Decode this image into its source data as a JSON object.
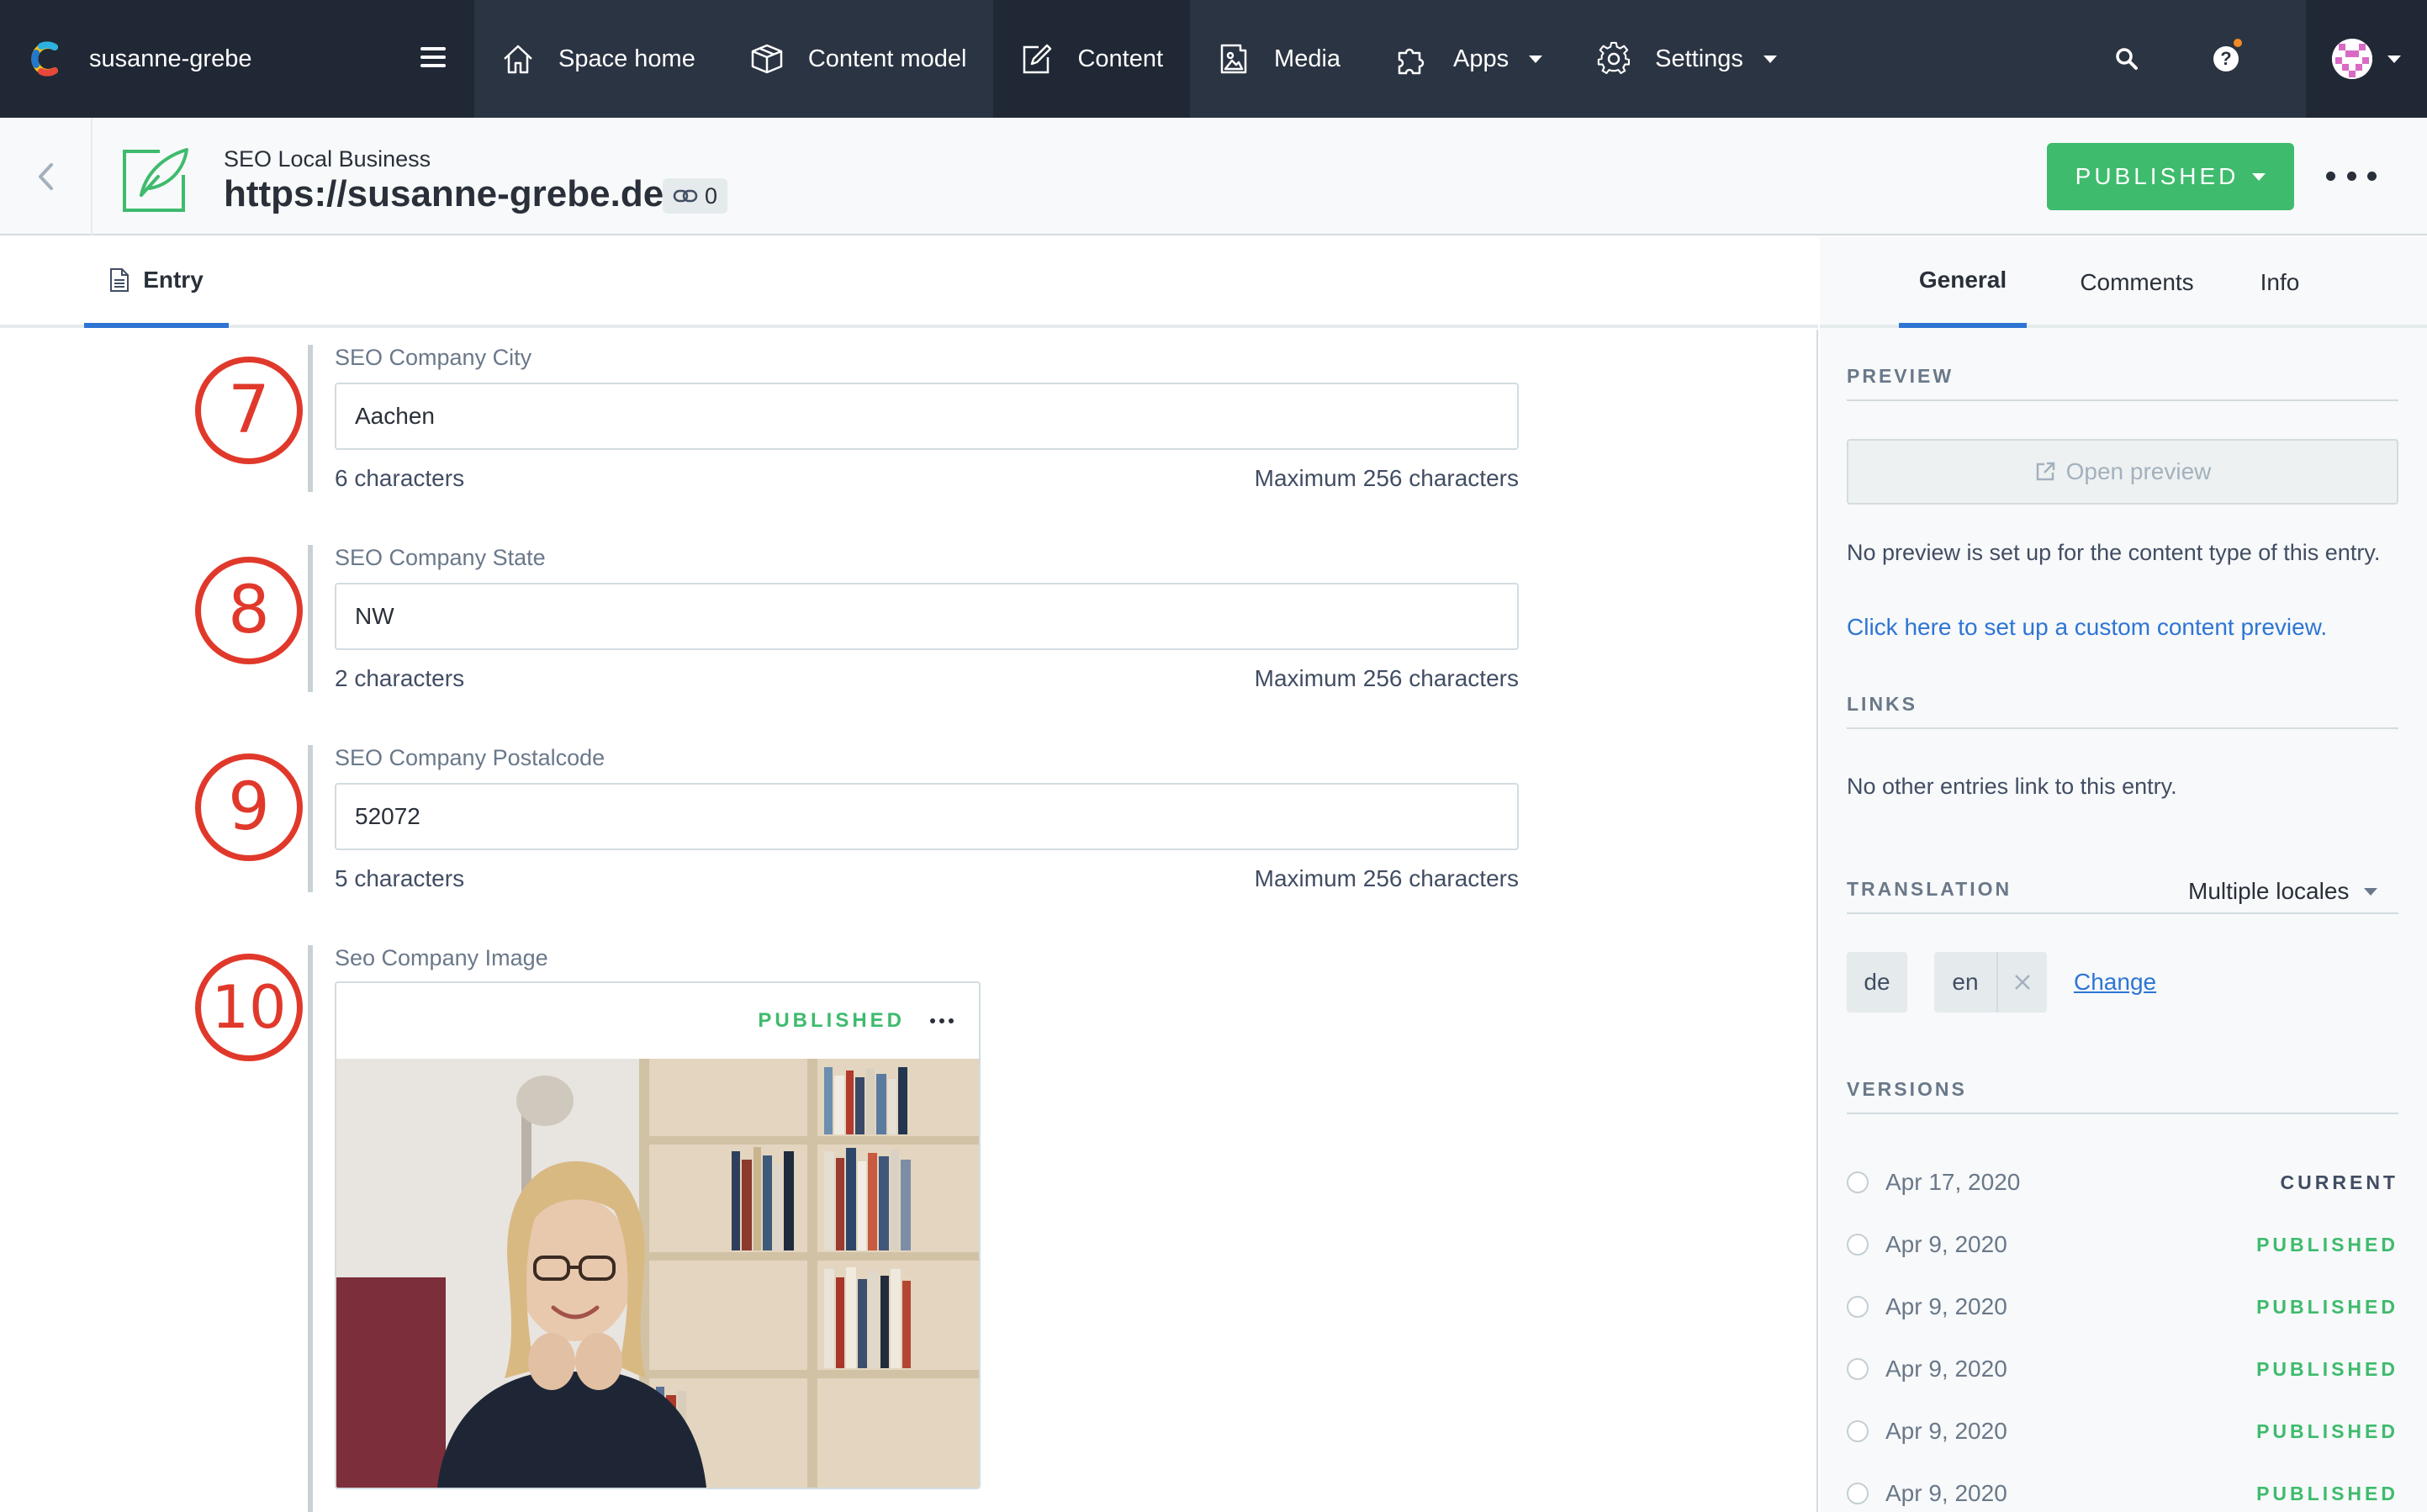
{
  "topnav": {
    "space_name": "susanne-grebe",
    "items": [
      {
        "label": "Space home",
        "icon": "home-icon"
      },
      {
        "label": "Content model",
        "icon": "content-model-icon"
      },
      {
        "label": "Content",
        "icon": "content-icon",
        "active": true
      },
      {
        "label": "Media",
        "icon": "media-icon"
      },
      {
        "label": "Apps",
        "icon": "puzzle-icon"
      },
      {
        "label": "Settings",
        "icon": "gear-icon"
      }
    ]
  },
  "entry_header": {
    "content_type": "SEO Local Business",
    "title": "https://susanne-grebe.de",
    "links_count": "0",
    "status_button": "PUBLISHED"
  },
  "editor": {
    "tab_label": "Entry",
    "fields": [
      {
        "step": "7",
        "label": "SEO Company City",
        "value": "Aachen",
        "count": "6 characters",
        "max": "Maximum 256 characters"
      },
      {
        "step": "8",
        "label": "SEO Company State",
        "value": "NW",
        "count": "2 characters",
        "max": "Maximum 256 characters"
      },
      {
        "step": "9",
        "label": "SEO Company Postalcode",
        "value": "52072",
        "count": "5 characters",
        "max": "Maximum 256 characters"
      }
    ],
    "image_field": {
      "step": "10",
      "label": "Seo Company Image",
      "status": "PUBLISHED"
    }
  },
  "sidebar": {
    "tabs": [
      "General",
      "Comments",
      "Info"
    ],
    "preview": {
      "title": "PREVIEW",
      "button": "Open preview",
      "text": "No preview is set up for the content type of this entry.",
      "link": "Click here to set up a custom content preview."
    },
    "links": {
      "title": "LINKS",
      "text": "No other entries link to this entry."
    },
    "translation": {
      "title": "TRANSLATION",
      "select": "Multiple locales",
      "locales": [
        "de",
        "en"
      ],
      "change": "Change"
    },
    "versions": {
      "title": "VERSIONS",
      "rows": [
        {
          "date": "Apr 17, 2020",
          "status": "CURRENT"
        },
        {
          "date": "Apr 9, 2020",
          "status": "PUBLISHED"
        },
        {
          "date": "Apr 9, 2020",
          "status": "PUBLISHED"
        },
        {
          "date": "Apr 9, 2020",
          "status": "PUBLISHED"
        },
        {
          "date": "Apr 9, 2020",
          "status": "PUBLISHED"
        },
        {
          "date": "Apr 9, 2020",
          "status": "PUBLISHED"
        }
      ]
    }
  },
  "colors": {
    "nav_bg": "#2b3442",
    "nav_dark": "#1f2834",
    "published_green": "#3ebb6d",
    "link_blue": "#2e75d4",
    "annotation_red": "#e0392b"
  }
}
